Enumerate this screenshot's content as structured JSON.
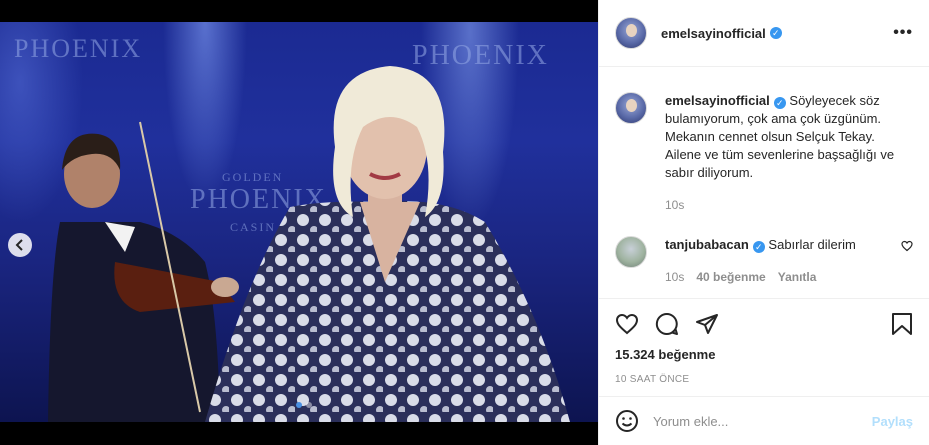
{
  "post": {
    "author": "emelsayinofficial",
    "image_overlay_texts": [
      "PHOENIX",
      "PHOENIX",
      "GOLDEN",
      "PHOENIX",
      "CASIN"
    ]
  },
  "caption": {
    "username": "emelsayinofficial",
    "text": "Söyleyecek söz bulamıyorum, çok ama çok üzgünüm. Mekanın cennet olsun Selçuk Tekay. Ailene ve tüm sevenlerine başsağlığı ve sabır diliyorum.",
    "time": "10s"
  },
  "comment": {
    "username": "tanjubabacan",
    "text": "Sabırlar dilerim",
    "time": "10s",
    "likes": "40 beğenme",
    "reply": "Yanıtla"
  },
  "actions": {
    "likes_count": "15.324 beğenme",
    "time_ago": "10 SAAT ÖNCE"
  },
  "add_comment": {
    "placeholder": "Yorum ekle...",
    "post_label": "Paylaş"
  },
  "colors": {
    "verified": "#3897f0",
    "active_dot": "#4a90e2",
    "post_button": "#b2dffc"
  },
  "icons": {
    "header_more": "more-icon",
    "nav": "chevron-left-icon",
    "like": "heart-icon",
    "comment": "comment-icon",
    "share": "share-icon",
    "save": "bookmark-icon",
    "emoji": "emoji-icon"
  }
}
